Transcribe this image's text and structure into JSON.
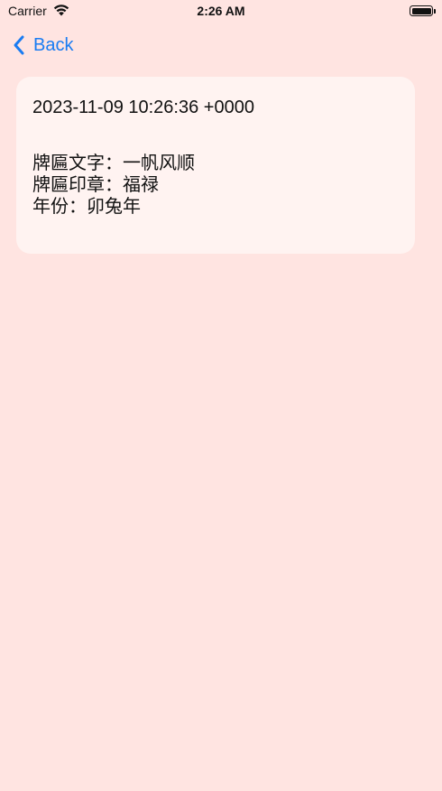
{
  "status_bar": {
    "carrier": "Carrier",
    "time": "2:26 AM",
    "icons": [
      "wifi-icon",
      "battery-icon"
    ]
  },
  "nav": {
    "back_label": "Back",
    "back_icon": "chevron-left-icon",
    "accent_color": "#1a7cf2"
  },
  "card": {
    "timestamp": "2023-11-09 10:26:36 +0000",
    "lines": [
      "牌匾文字：一帆风顺",
      "牌匾印章：福禄",
      "年份：卯兔年"
    ]
  },
  "colors": {
    "background": "#ffe4e1",
    "card": "#fff3f1"
  }
}
